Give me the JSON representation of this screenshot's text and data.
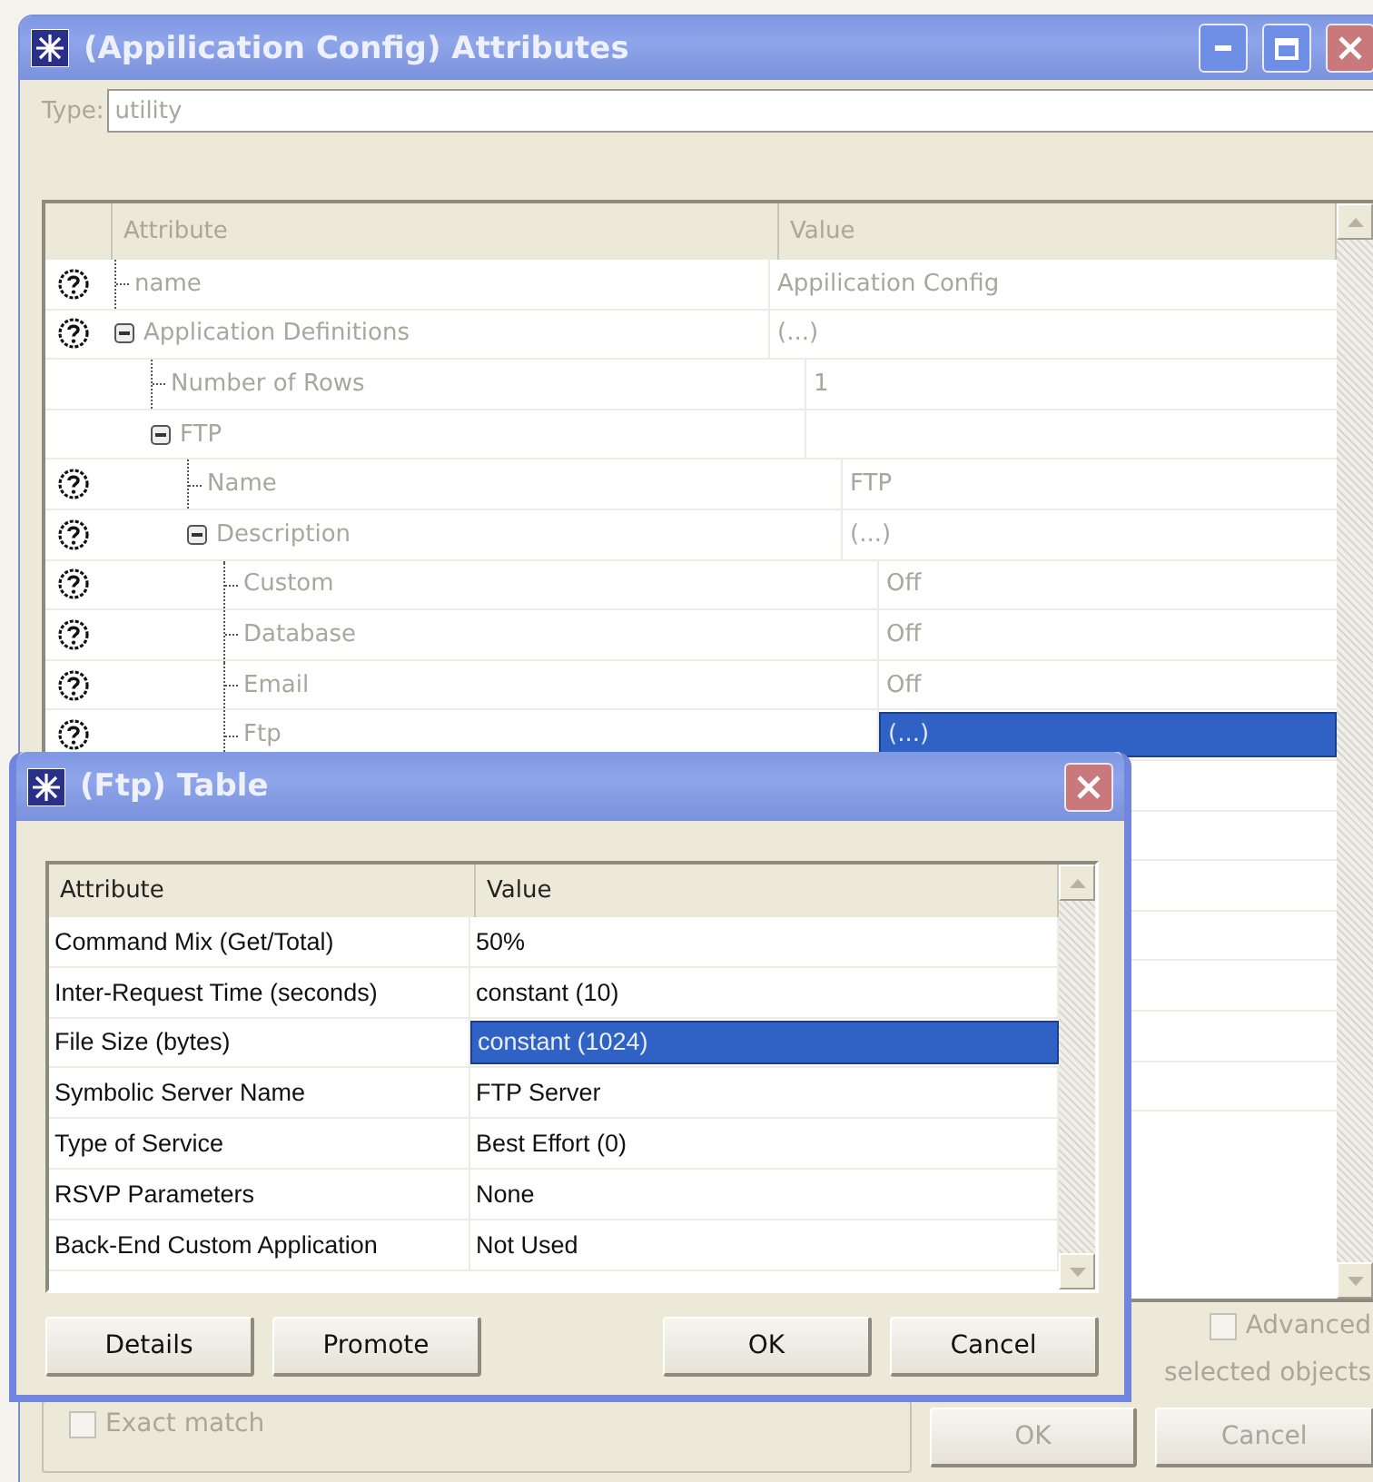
{
  "window": {
    "title": "(Appilication Config) Attributes",
    "type_label": "Type:",
    "type_value": "utility"
  },
  "attributes": {
    "columns": [
      "Attribute",
      "Value"
    ],
    "rows": [
      {
        "name": "name",
        "value": "Appilication Config",
        "help": true,
        "selected": false
      },
      {
        "name": "Application Definitions",
        "value": "(...)",
        "help": true,
        "selected": false,
        "expanded": true,
        "children": [
          {
            "name": "Number of Rows",
            "value": "1",
            "help": false,
            "selected": false
          },
          {
            "name": "FTP",
            "help": false,
            "selected": false,
            "expanded": true,
            "children": [
              {
                "name": "Name",
                "value": "FTP",
                "help": true,
                "selected": false
              },
              {
                "name": "Description",
                "value": "(...)",
                "help": true,
                "selected": false,
                "expanded": true,
                "children": [
                  {
                    "name": "Custom",
                    "value": "Off",
                    "help": true,
                    "selected": false
                  },
                  {
                    "name": "Database",
                    "value": "Off",
                    "help": true,
                    "selected": false
                  },
                  {
                    "name": "Email",
                    "value": "Off",
                    "help": true,
                    "selected": false
                  },
                  {
                    "name": "Ftp",
                    "value": "(...)",
                    "help": true,
                    "selected": true
                  }
                ]
              }
            ]
          }
        ]
      }
    ]
  },
  "advanced": {
    "label": "Advanced",
    "checked": false
  },
  "selected_objects_text": "selected objects",
  "exact_match": {
    "label": "Exact match",
    "checked": false
  },
  "buttons": [
    {
      "label": "OK"
    },
    {
      "label": "Cancel"
    }
  ],
  "dialog": {
    "title": "(Ftp) Table",
    "columns": [
      "Attribute",
      "Value"
    ],
    "rows": [
      {
        "attribute": "Command Mix (Get/Total)",
        "value": "50%",
        "selected": false
      },
      {
        "attribute": "Inter-Request Time (seconds)",
        "value": "constant (10)",
        "selected": false
      },
      {
        "attribute": "File Size (bytes)",
        "value": "constant (1024)",
        "selected": true
      },
      {
        "attribute": "Symbolic Server Name",
        "value": "FTP Server",
        "selected": false
      },
      {
        "attribute": "Type of Service",
        "value": "Best Effort (0)",
        "selected": false
      },
      {
        "attribute": "RSVP Parameters",
        "value": "None",
        "selected": false
      },
      {
        "attribute": "Back-End Custom Application",
        "value": "Not Used",
        "selected": false
      }
    ],
    "buttons": [
      {
        "label": "Details",
        "kind": "left"
      },
      {
        "label": "Promote",
        "kind": "left"
      },
      {
        "label": "OK",
        "kind": "right"
      },
      {
        "label": "Cancel",
        "kind": "right"
      }
    ]
  }
}
